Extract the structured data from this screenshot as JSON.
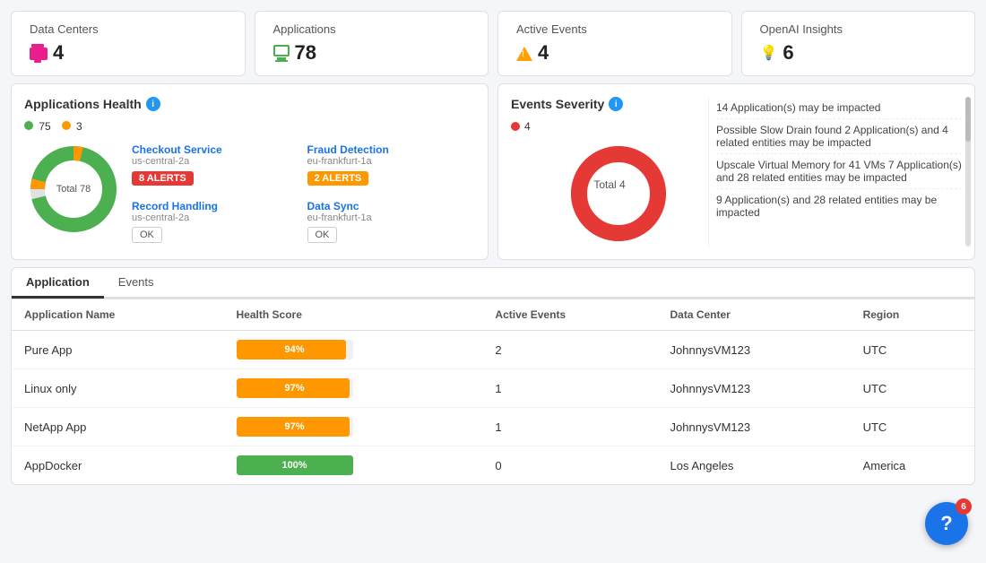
{
  "topCards": [
    {
      "id": "data-centers",
      "title": "Data Centers",
      "value": "4",
      "icon": "dc-icon"
    },
    {
      "id": "applications",
      "title": "Applications",
      "value": "78",
      "icon": "monitor-icon"
    },
    {
      "id": "active-events",
      "title": "Active Events",
      "value": "4",
      "icon": "warning-icon"
    },
    {
      "id": "openai-insights",
      "title": "OpenAI Insights",
      "value": "6",
      "icon": "bulb-icon"
    }
  ],
  "appHealth": {
    "title": "Applications Health",
    "greenCount": "75",
    "orangeCount": "3",
    "totalLabel": "Total 78",
    "apps": [
      {
        "name": "Checkout Service",
        "location": "us-central-2a",
        "badgeText": "8 ALERTS",
        "badgeType": "red"
      },
      {
        "name": "Fraud Detection",
        "location": "eu-frankfurt-1a",
        "badgeText": "2 ALERTS",
        "badgeType": "orange"
      },
      {
        "name": "Record Handling",
        "location": "us-central-2a",
        "badgeText": "OK",
        "badgeType": "ok"
      },
      {
        "name": "Data Sync",
        "location": "eu-frankfurt-1a",
        "badgeText": "OK",
        "badgeType": "ok"
      }
    ]
  },
  "eventsSeverity": {
    "title": "Events Severity",
    "criticalCount": "4",
    "totalLabel": "Total 4",
    "messages": [
      "14 Application(s) may be impacted",
      "Possible Slow Drain found 2 Application(s) and 4 related entities may be impacted",
      "Upscale Virtual Memory for 41 VMs 7 Application(s) and 28 related entities may be impacted",
      "9 Application(s) and 28 related entities may be impacted"
    ]
  },
  "tabs": [
    {
      "id": "application",
      "label": "Application",
      "active": true
    },
    {
      "id": "events",
      "label": "Events",
      "active": false
    }
  ],
  "table": {
    "columns": [
      "Application Name",
      "Health Score",
      "Active Events",
      "Data Center",
      "Region"
    ],
    "rows": [
      {
        "name": "Pure App",
        "healthScore": 94,
        "healthLabel": "94%",
        "activeEvents": "2",
        "dataCenter": "JohnnysVM123",
        "region": "UTC",
        "barColor": "#FF9800"
      },
      {
        "name": "Linux only",
        "healthScore": 97,
        "healthLabel": "97%",
        "activeEvents": "1",
        "dataCenter": "JohnnysVM123",
        "region": "UTC",
        "barColor": "#FF9800"
      },
      {
        "name": "NetApp App",
        "healthScore": 97,
        "healthLabel": "97%",
        "activeEvents": "1",
        "dataCenter": "JohnnysVM123",
        "region": "UTC",
        "barColor": "#FF9800"
      },
      {
        "name": "AppDocker",
        "healthScore": 100,
        "healthLabel": "100%",
        "activeEvents": "0",
        "dataCenter": "Los Angeles",
        "region": "America",
        "barColor": "#4CAF50"
      }
    ]
  },
  "helpFab": {
    "badgeCount": "6",
    "label": "?"
  }
}
